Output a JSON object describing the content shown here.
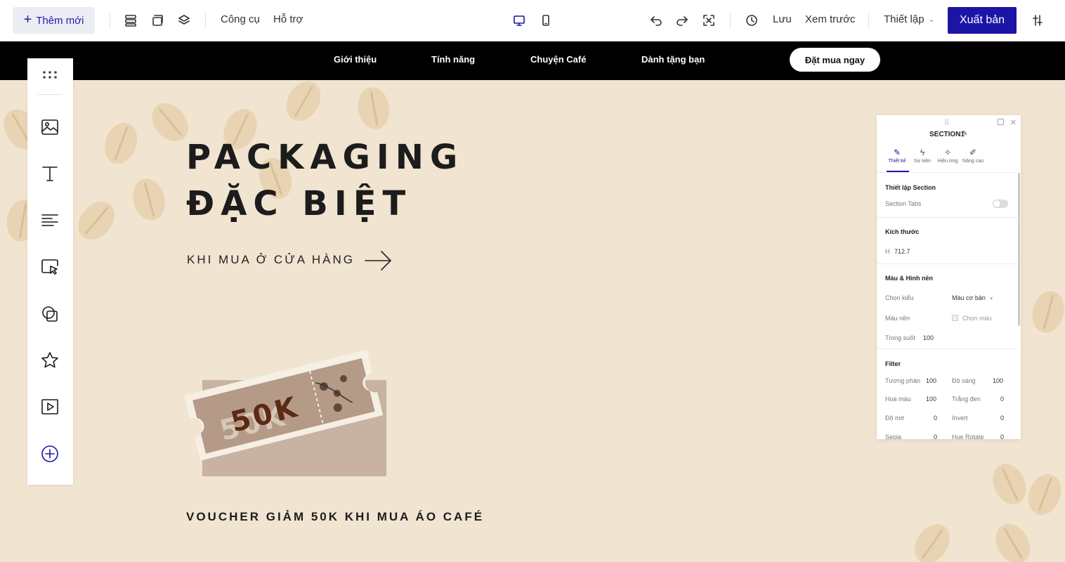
{
  "toolbar": {
    "add_new": "Thêm mới",
    "tools": "Công cụ",
    "support": "Hỗ trợ",
    "save": "Lưu",
    "preview": "Xem trước",
    "settings": "Thiết lập",
    "publish": "Xuất bản",
    "accent_color": "#1b15a6"
  },
  "site_nav": {
    "items": [
      "Giới thiệu",
      "Tính năng",
      "Chuyện Café",
      "Dành tặng bạn"
    ],
    "cta": "Đặt mua ngay"
  },
  "hero": {
    "title_line1": "PACKAGING",
    "title_line2": "ĐẶC BIỆT",
    "subtitle": "KHI MUA Ở CỬA HÀNG",
    "voucher_amount": "50K",
    "voucher_caption": "VOUCHER GIẢM 50K KHI MUA ÁO CAFÉ"
  },
  "left_panel": {
    "icons": [
      "grid-dots-icon",
      "image-icon",
      "text-icon",
      "paragraph-icon",
      "cursor-select-icon",
      "shape-icon",
      "star-icon",
      "video-icon",
      "add-circle-icon"
    ]
  },
  "settings_panel": {
    "title": "SECTION1",
    "tabs": [
      "Thiết kế",
      "Sự kiện",
      "Hiệu ứng",
      "Nâng cao"
    ],
    "section_settings": {
      "heading": "Thiết lập Section",
      "tabs_label": "Section Tabs",
      "tabs_enabled": false
    },
    "size": {
      "heading": "Kích thước",
      "h_label": "H",
      "h_value": "712.7"
    },
    "background": {
      "heading": "Màu & Hình nền",
      "type_label": "Chọn kiểu",
      "type_value": "Màu cơ bản",
      "color_label": "Màu nền",
      "color_value": "Chọn màu",
      "opacity_label": "Trong suốt",
      "opacity_value": "100"
    },
    "filter": {
      "heading": "Filter",
      "rows": [
        {
          "l1": "Tương phản",
          "v1": "100",
          "l2": "Độ sáng",
          "v2": "100"
        },
        {
          "l1": "Hoà màu",
          "v1": "100",
          "l2": "Trắng đen",
          "v2": "0"
        },
        {
          "l1": "Độ mờ",
          "v1": "0",
          "l2": "Invert",
          "v2": "0"
        },
        {
          "l1": "Sepia",
          "v1": "0",
          "l2": "Hue Rotate",
          "v2": "0"
        }
      ]
    }
  }
}
